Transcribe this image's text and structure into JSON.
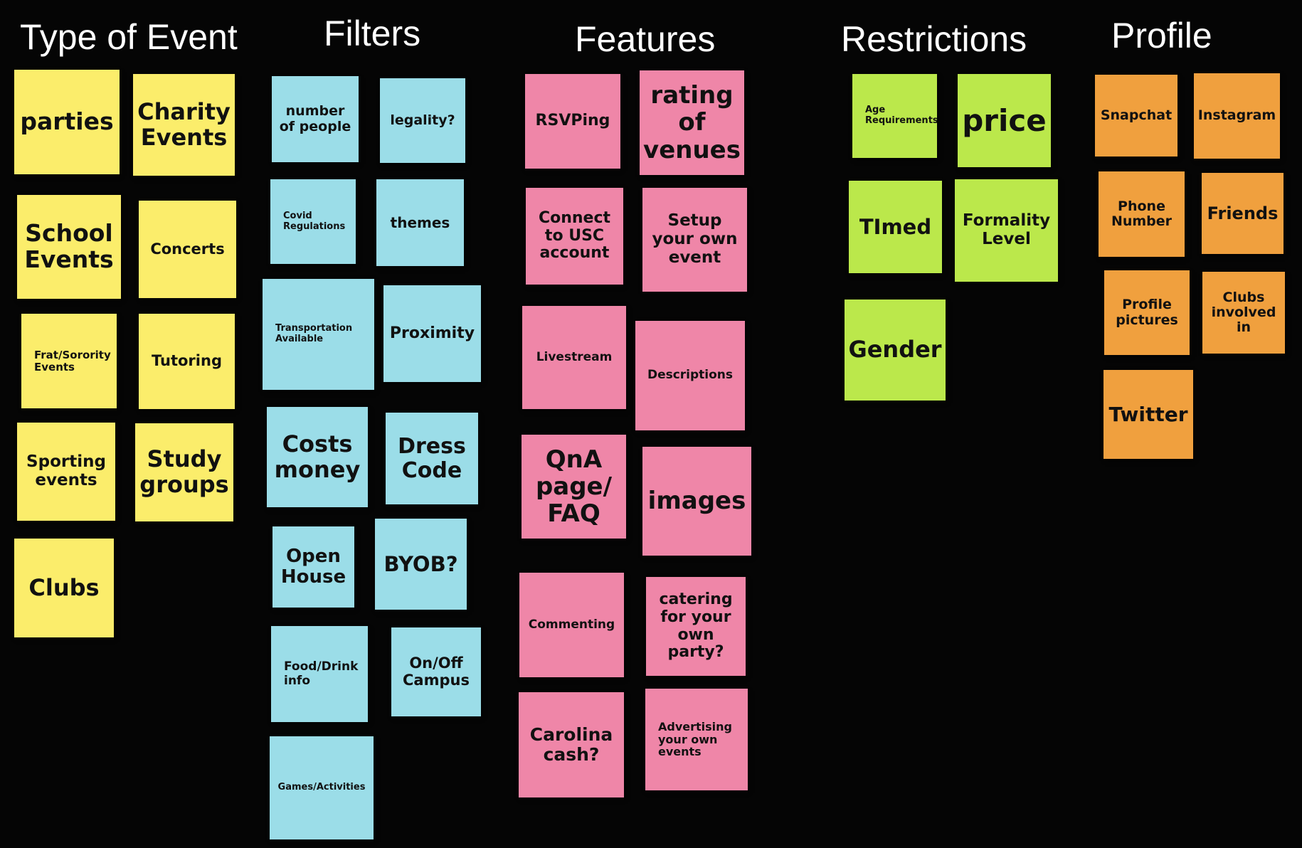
{
  "colors": {
    "background": "#050505",
    "yellow": "#fbed6b",
    "blue": "#9bdde8",
    "pink": "#ef86a8",
    "green": "#bbe84b",
    "orange": "#f0a03e"
  },
  "columns": {
    "type_of_event": {
      "title": "Type of Event",
      "notes": [
        "parties",
        "Charity Events",
        "School Events",
        "Concerts",
        "Frat/Sorority Events",
        "Tutoring",
        "Sporting events",
        "Study groups",
        "Clubs"
      ]
    },
    "filters": {
      "title": "Filters",
      "notes": [
        "number of people",
        "legality?",
        "Covid Regulations",
        "themes",
        "Transportation Available",
        "Proximity",
        "Costs money",
        "Dress Code",
        "Open House",
        "BYOB?",
        "Food/Drink info",
        "On/Off Campus",
        "Games/Activities"
      ]
    },
    "features": {
      "title": "Features",
      "notes": [
        "RSVPing",
        "rating of venues",
        "Connect to USC account",
        "Setup your own event",
        "Livestream",
        "Descriptions",
        "QnA page/ FAQ",
        "images",
        "Commenting",
        "catering for your own party?",
        "Carolina cash?",
        "Advertising your own events"
      ]
    },
    "restrictions": {
      "title": "Restrictions",
      "notes": [
        "Age Requirements",
        "price",
        "TImed",
        "Formality Level",
        "Gender"
      ]
    },
    "profile": {
      "title": "Profile",
      "notes": [
        "Snapchat",
        "Instagram",
        "Phone Number",
        "Friends",
        "Profile pictures",
        "Clubs involved in",
        "Twitter"
      ]
    }
  }
}
